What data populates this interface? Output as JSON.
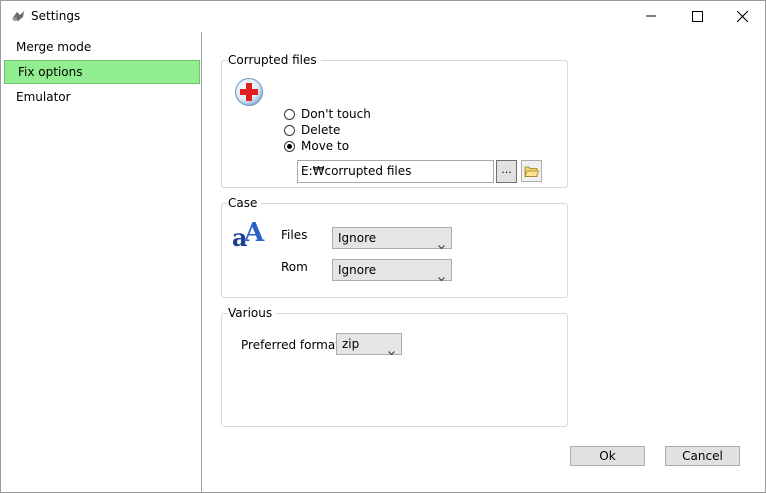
{
  "window": {
    "title": "Settings",
    "controls": {
      "minimize": "minimize-icon",
      "maximize": "maximize-icon",
      "close": "close-icon"
    }
  },
  "sidebar": {
    "items": [
      {
        "label": "Merge mode",
        "selected": false
      },
      {
        "label": "Fix options",
        "selected": true
      },
      {
        "label": "Emulator",
        "selected": false
      }
    ],
    "selected_color": "#90ee90"
  },
  "corrupted_files": {
    "title": "Corrupted files",
    "icon": "red-cross-icon",
    "options": [
      {
        "label": "Don't touch",
        "checked": false
      },
      {
        "label": "Delete",
        "checked": false
      },
      {
        "label": "Move to",
        "checked": true
      }
    ],
    "path_value": "E:₩corrupted files",
    "browse_label": "...",
    "folder_icon": "folder-icon"
  },
  "case": {
    "title": "Case",
    "icon": "letter-case-icon",
    "files_label": "Files",
    "files_value": "Ignore",
    "rom_label": "Rom",
    "rom_value": "Ignore"
  },
  "various": {
    "title": "Various",
    "format_label": "Preferred format",
    "format_value": "zip"
  },
  "buttons": {
    "ok": "Ok",
    "cancel": "Cancel"
  }
}
